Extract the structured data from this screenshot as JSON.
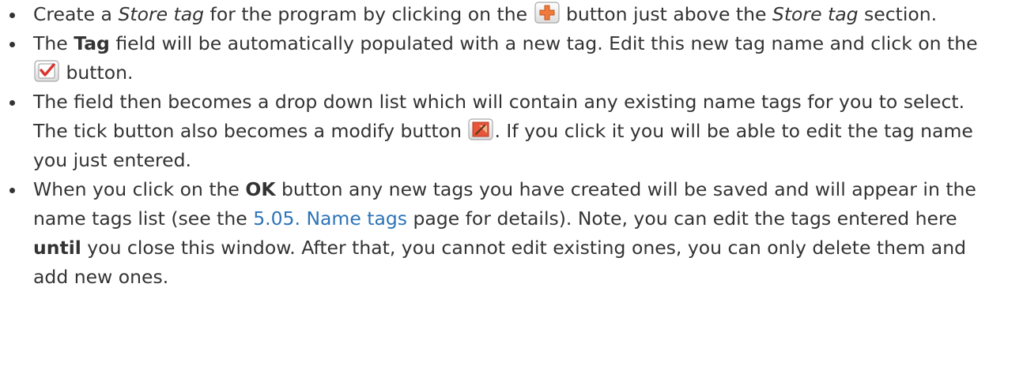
{
  "page": {
    "link_color": "#2b73b7",
    "text_color": "#333333"
  },
  "steps": [
    {
      "t1": "Create a ",
      "em1": "Store tag",
      "t2": " for the program by clicking on the ",
      "icon": "add-icon",
      "t3": " button just above the ",
      "em2": "Store tag",
      "t4": " section."
    },
    {
      "t1": "The ",
      "b1": "Tag",
      "t2": " field will be automatically populated with a new tag. Edit this new tag name and click on the ",
      "icon": "tick-icon",
      "t3": " button."
    },
    {
      "t1": "The field then becomes a drop down list which will contain any existing name tags for you to select. The tick button also becomes a modify button ",
      "icon": "modify-icon",
      "t2": ". If you click it you will be able to edit the tag name you just entered."
    },
    {
      "t1": "When you click on the ",
      "b1": "OK",
      "t2": " button any new tags you have created will be saved and will appear in the name tags list (see the ",
      "link": "5.05. Name tags",
      "t3": " page for details). Note, you can edit the tags entered here ",
      "b2": "until",
      "t4": " you close this window. After that, you cannot edit existing ones, you can only delete them and add new ones."
    }
  ]
}
